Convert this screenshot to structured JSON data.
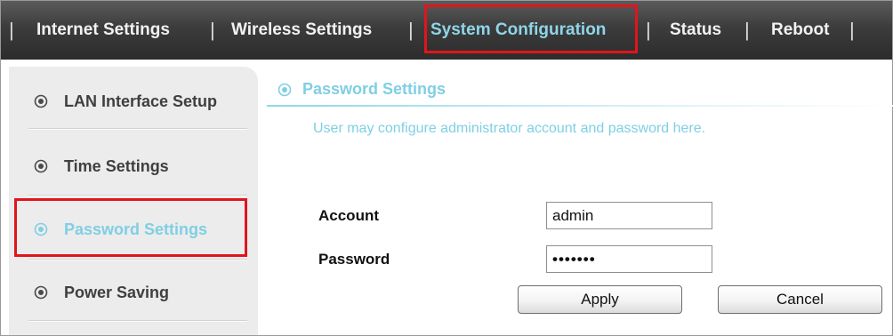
{
  "nav": {
    "items": [
      "Internet Settings",
      "Wireless Settings",
      "System Configuration",
      "Status",
      "Reboot"
    ],
    "separator": "|",
    "active": "System Configuration"
  },
  "sidebar": {
    "items": [
      {
        "label": "LAN Interface Setup"
      },
      {
        "label": "Time Settings"
      },
      {
        "label": "Password Settings"
      },
      {
        "label": "Power Saving"
      }
    ],
    "active": "Password Settings"
  },
  "section": {
    "title": "Password Settings",
    "description": "User may configure administrator account and password here."
  },
  "form": {
    "account_label": "Account",
    "account_value": "admin",
    "password_label": "Password",
    "password_value": "•••••••"
  },
  "buttons": {
    "apply": "Apply",
    "cancel": "Cancel"
  },
  "colors": {
    "accent": "#7fcfe4",
    "nav_bg": "#3c3c3c",
    "highlight": "#e2141b",
    "sidebar_bg": "#ececec"
  },
  "icons": {
    "sidebar_bullet": "radio-circle-icon",
    "section_bullet": "radio-circle-icon"
  }
}
